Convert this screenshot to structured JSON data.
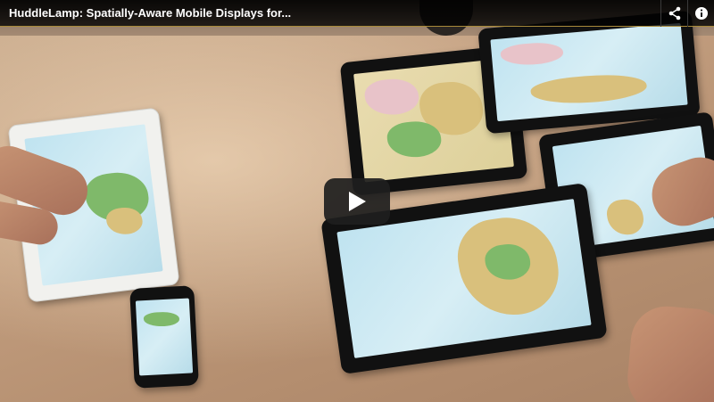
{
  "player": {
    "title": "HuddleLamp: Spatially-Aware Mobile Displays for...",
    "share_icon": "share-icon",
    "info_icon": "info-icon",
    "play_icon": "play-icon",
    "accent_color": "#a88a3a"
  }
}
